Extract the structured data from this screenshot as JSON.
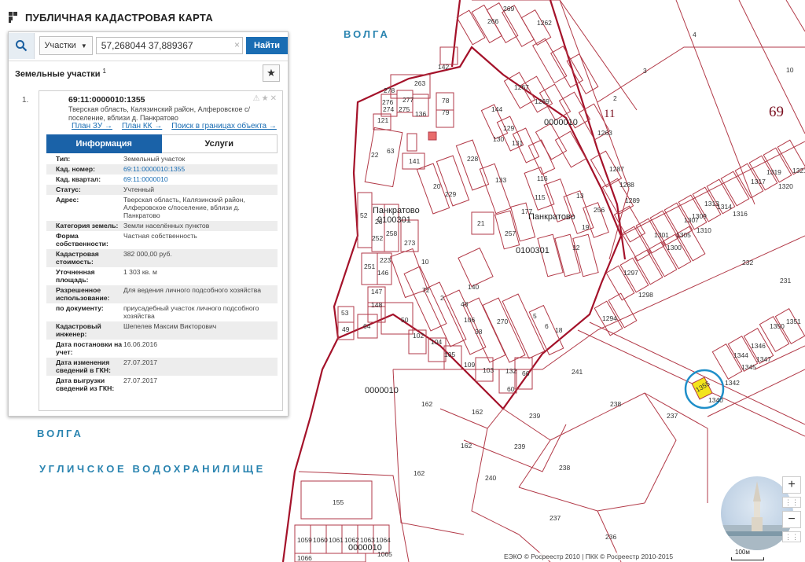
{
  "app": {
    "title": "ПУБЛИЧНАЯ КАДАСТРОВАЯ КАРТА"
  },
  "search": {
    "type_label": "Участки",
    "query": "57,268044 37,889367",
    "find_label": "Найти",
    "clear": "×"
  },
  "results": {
    "header": "Земельные участки",
    "count": "1",
    "item": {
      "index": "1.",
      "cadastral_number": "69:11:0000010:1355",
      "address": "Тверская область, Калязинский район, Алферовское с/поселение, вблизи д. Панкратово",
      "links": [
        "План ЗУ →",
        "План КК →",
        "Поиск в границах объекта →"
      ]
    },
    "tabs": {
      "info": "Информация",
      "services": "Услуги"
    },
    "properties": [
      {
        "key": "Тип:",
        "value": "Земельный участок"
      },
      {
        "key": "Кад. номер:",
        "value": "69:11:0000010:1355",
        "link": true
      },
      {
        "key": "Кад. квартал:",
        "value": "69:11:0000010",
        "link": true
      },
      {
        "key": "Статус:",
        "value": "Учтенный"
      },
      {
        "key": "Адрес:",
        "value": "Тверская область, Калязинский район, Алферовское с/поселение, вблизи д. Панкратово"
      },
      {
        "key": "Категория земель:",
        "value": "Земли населённых пунктов"
      },
      {
        "key": "Форма собственности:",
        "value": "Частная собственность"
      },
      {
        "key": "Кадастровая стоимость:",
        "value": "382 000,00 руб."
      },
      {
        "key": "Уточненная площадь:",
        "value": "1 303 кв. м"
      },
      {
        "key": "Разрешенное использование:",
        "value": "Для ведения личного подсобного хозяйства"
      },
      {
        "key": "по документу:",
        "value": "приусадебный участок личного подсобного хозяйства"
      },
      {
        "key": "Кадастровый инженер:",
        "value": "Шепелев Максим Викторович"
      },
      {
        "key": "Дата постановки на учет:",
        "value": "16.06.2016"
      },
      {
        "key": "Дата изменения сведений в ГКН:",
        "value": "27.07.2017"
      },
      {
        "key": "Дата выгрузки сведений из ГКН:",
        "value": "27.07.2017"
      }
    ]
  },
  "map": {
    "water_labels": {
      "volga_top": "ВОЛГА",
      "volga_left": "ВОЛГА",
      "reservoir": "УГЛИЧСКОЕ ВОДОХРАНИЛИЩЕ"
    },
    "villages": {
      "v1": "Панкратово",
      "v2": "Панкратово"
    },
    "quarters": {
      "q1": "0100301",
      "q2": "0100301",
      "q3": "0000010",
      "q4": "0000010",
      "q5": "0000010"
    },
    "big_numbers": {
      "b1": "69",
      "b2": "11",
      "b3": "10"
    },
    "selected_parcel": "1355",
    "highlight_color": "#f3e41b",
    "circle_color": "#1f8fc9",
    "boundary_color": "#a4122a",
    "parcel_color": "#b23a48",
    "parcels": {
      "p263": "263",
      "p142": "142",
      "p278": "278",
      "p277": "277",
      "p276": "276",
      "p274": "274",
      "p275": "275",
      "p136": "136",
      "p78": "78",
      "p79": "79",
      "p144": "144",
      "p129": "129",
      "p130": "130",
      "p131": "131",
      "p121": "121",
      "p63": "63",
      "p141": "141",
      "p22": "22",
      "p20": "20",
      "p229": "229",
      "p228": "228",
      "p133": "133",
      "p116": "116",
      "p115": "115",
      "p13": "13",
      "p256": "256",
      "p19": "19",
      "p21": "21",
      "p257": "257",
      "p177": "177",
      "p12": "12",
      "p52": "52",
      "p26": "26",
      "p258": "258",
      "p252": "252",
      "p273": "273",
      "p10": "10",
      "p223": "223",
      "p251": "251",
      "p146": "146",
      "p147": "147",
      "p148": "148",
      "p140": "140",
      "p2": "2",
      "p48": "48",
      "p72": "72",
      "p53": "53",
      "p49": "49",
      "p64": "64",
      "p50": "50",
      "p102": "102",
      "p104": "104",
      "p105": "105",
      "p38": "38",
      "p106": "106",
      "p109": "109",
      "p103": "103",
      "p132": "132",
      "p66": "66",
      "p60": "60",
      "p270": "270",
      "p5": "5",
      "p18": "18",
      "p6": "6",
      "p241": "241",
      "p162a": "162",
      "p162b": "162",
      "p162c": "162",
      "p162d": "162",
      "p239a": "239",
      "p239b": "239",
      "p240": "240",
      "p238a": "238",
      "p238b": "238",
      "p237a": "237",
      "p237b": "237",
      "p236": "236",
      "p155": "155",
      "p232": "232",
      "p231": "231",
      "p3": "3",
      "p4": "4",
      "p2top": "2",
      "p1301": "1301",
      "p1297": "1297",
      "p1298": "1298",
      "p1294": "1294",
      "p1313": "1313",
      "p1314": "1314",
      "p1344": "1344",
      "p1345": "1345",
      "p1346": "1346",
      "p1347": "1347",
      "p1340": "1340",
      "p1342": "1342",
      "p1350": "1350",
      "p1351": "1351",
      "p1288": "1288",
      "p1287": "1287",
      "p1289": "1289",
      "p1269": "1269",
      "p1267": "1267",
      "p1263": "1263",
      "p269": "269",
      "p266": "266",
      "p1262": "1262",
      "p1059": "1059",
      "p1060": "1060",
      "p1061": "1061",
      "p1062": "1062",
      "p1063": "1063",
      "p1064": "1064",
      "p1065": "1065",
      "p1066": "1066",
      "p1300": "1300",
      "p1305": "1305",
      "p1307": "1307",
      "p1309": "1309",
      "p1310": "1310",
      "p1317": "1317",
      "p1320": "1320",
      "p1319": "1319",
      "p1316": "1316",
      "p1321": "1321"
    }
  },
  "controls": {
    "zoom_in": "+",
    "zoom_out": "−",
    "scale": "100м"
  },
  "attribution": "ЕЭКО © Росреестр 2010 | ПКК © Росреестр 2010-2015"
}
